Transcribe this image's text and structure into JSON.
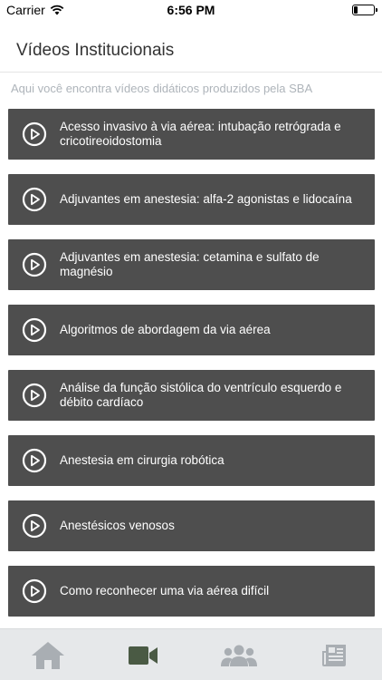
{
  "status_bar": {
    "carrier": "Carrier",
    "time": "6:56 PM",
    "battery_level": 0.2
  },
  "header": {
    "title": "Vídeos Institucionais"
  },
  "subtitle": "Aqui você encontra vídeos didáticos produzidos pela SBA",
  "videos": [
    {
      "label": "Acesso invasivo à via aérea: intubação retrógrada e cricotireoidostomia",
      "icon": "play-circle-icon"
    },
    {
      "label": "Adjuvantes em anestesia: alfa-2 agonistas e lidocaína",
      "icon": "play-circle-icon"
    },
    {
      "label": "Adjuvantes em anestesia: cetamina e sulfato de magnésio",
      "icon": "play-circle-icon"
    },
    {
      "label": "Algoritmos de abordagem da via aérea",
      "icon": "play-circle-icon"
    },
    {
      "label": "Análise da função sistólica do ventrículo esquerdo e débito cardíaco",
      "icon": "play-circle-icon"
    },
    {
      "label": "Anestesia em cirurgia robótica",
      "icon": "play-circle-icon"
    },
    {
      "label": "Anestésicos venosos",
      "icon": "play-circle-icon"
    },
    {
      "label": "Como reconhecer uma via aérea difícil",
      "icon": "play-circle-icon"
    }
  ],
  "tab_bar": {
    "tabs": [
      {
        "icon": "home-icon",
        "active": false
      },
      {
        "icon": "video-camera-icon",
        "active": true
      },
      {
        "icon": "group-icon",
        "active": false
      },
      {
        "icon": "newspaper-icon",
        "active": false
      }
    ]
  },
  "colors": {
    "item_background": "#4e4e4e",
    "subtitle_text": "#aeb4ba",
    "tab_active": "#4a5a44",
    "tab_inactive": "#a9aeb3"
  }
}
